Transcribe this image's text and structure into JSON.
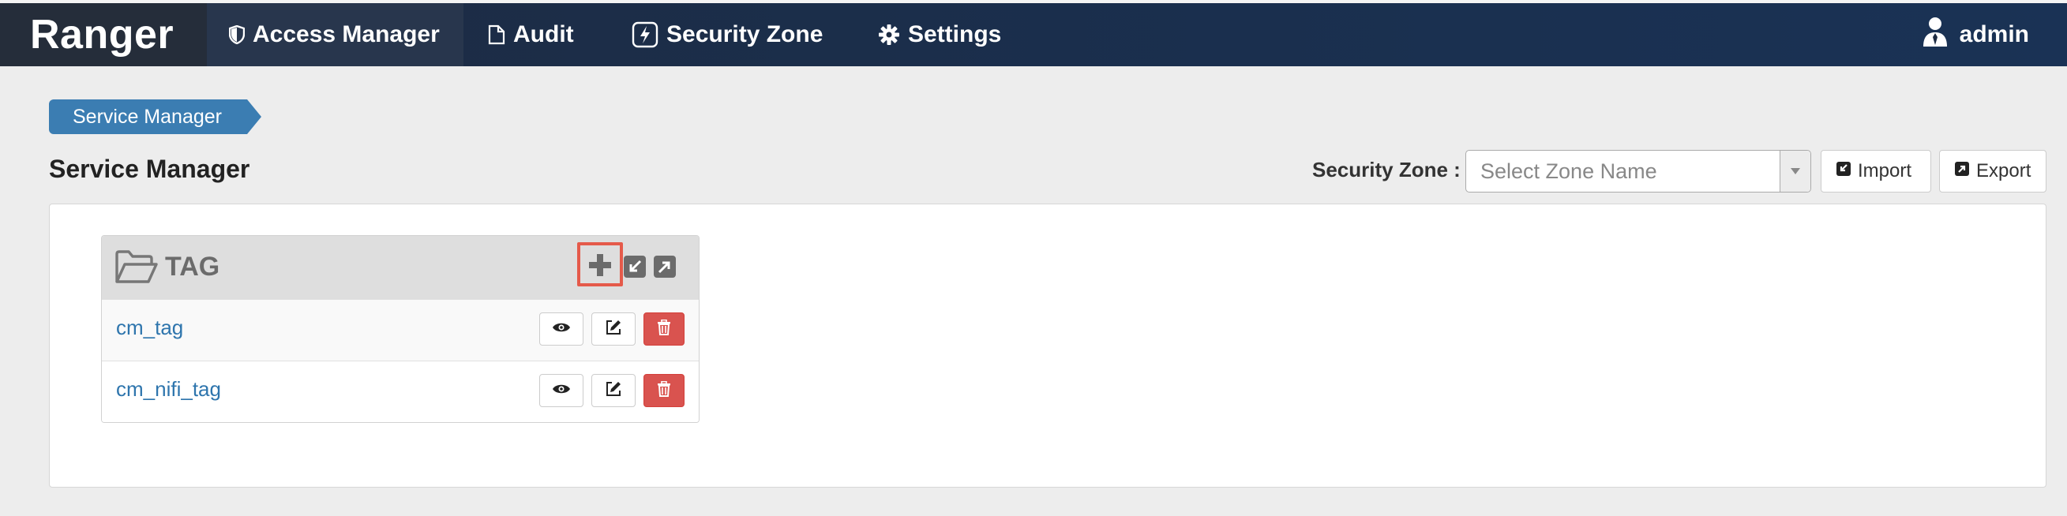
{
  "app": {
    "brand": "Ranger"
  },
  "nav": {
    "items": [
      {
        "label": "Access Manager",
        "icon": "shield-icon"
      },
      {
        "label": "Audit",
        "icon": "file-icon"
      },
      {
        "label": "Security Zone",
        "icon": "lightning-icon"
      },
      {
        "label": "Settings",
        "icon": "gear-icon"
      }
    ],
    "user": "admin"
  },
  "breadcrumb": {
    "label": "Service Manager"
  },
  "page": {
    "title": "Service Manager"
  },
  "zone": {
    "label": "Security Zone :",
    "placeholder": "Select Zone Name"
  },
  "actions": {
    "import_label": "Import",
    "export_label": "Export"
  },
  "service_group": {
    "title": "TAG",
    "services": [
      {
        "name": "cm_tag"
      },
      {
        "name": "cm_nifi_tag"
      }
    ]
  },
  "colors": {
    "accent": "#3b7db2",
    "danger": "#d9534f",
    "highlight": "#e55a4a",
    "navbar": "#1a2f4e"
  }
}
